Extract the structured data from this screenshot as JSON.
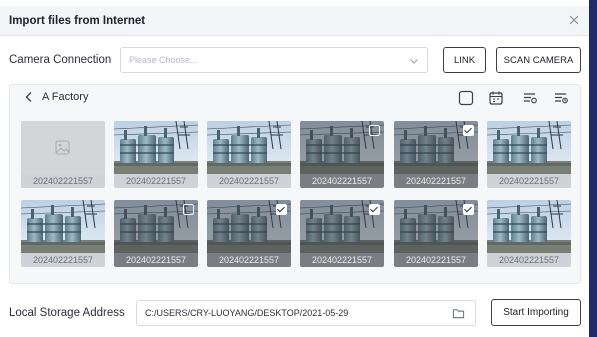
{
  "dialog": {
    "title": "Import files from Internet",
    "close_icon": "close-icon"
  },
  "camera": {
    "label": "Camera Connection",
    "placeholder": "Please Choose...",
    "link_label": "LINK",
    "scan_label": "SCAN CAMERA"
  },
  "gallery": {
    "folder_name": "A Factory",
    "toolbar_icons": [
      "select-all-checkbox-icon",
      "calendar-icon",
      "filter-list-icon",
      "sort-list-icon"
    ],
    "items": [
      {
        "caption": "202402221557",
        "kind": "placeholder",
        "selected": false,
        "checkbox": "none"
      },
      {
        "caption": "202402221557",
        "kind": "photo",
        "selected": false,
        "checkbox": "none"
      },
      {
        "caption": "202402221557",
        "kind": "photo",
        "selected": false,
        "checkbox": "none"
      },
      {
        "caption": "202402221557",
        "kind": "photo",
        "selected": true,
        "checkbox": "empty"
      },
      {
        "caption": "202402221557",
        "kind": "photo",
        "selected": true,
        "checkbox": "checked"
      },
      {
        "caption": "202402221557",
        "kind": "photo",
        "selected": false,
        "checkbox": "none"
      },
      {
        "caption": "202402221557",
        "kind": "photo",
        "selected": false,
        "checkbox": "none"
      },
      {
        "caption": "202402221557",
        "kind": "photo",
        "selected": true,
        "checkbox": "empty"
      },
      {
        "caption": "202402221557",
        "kind": "photo",
        "selected": true,
        "checkbox": "checked"
      },
      {
        "caption": "202402221557",
        "kind": "photo",
        "selected": true,
        "checkbox": "checked"
      },
      {
        "caption": "202402221557",
        "kind": "photo",
        "selected": true,
        "checkbox": "checked"
      },
      {
        "caption": "202402221557",
        "kind": "photo",
        "selected": false,
        "checkbox": "none"
      }
    ]
  },
  "storage": {
    "label": "Local Storage Address",
    "path": "C:/USERS/CRY-LUOYANG/DESKTOP/2021-05-29",
    "start_label": "Start Importing"
  },
  "colors": {
    "accent_dark": "#1f2a66",
    "border": "#d6d9e0",
    "header_bg": "#f4f5f8"
  }
}
